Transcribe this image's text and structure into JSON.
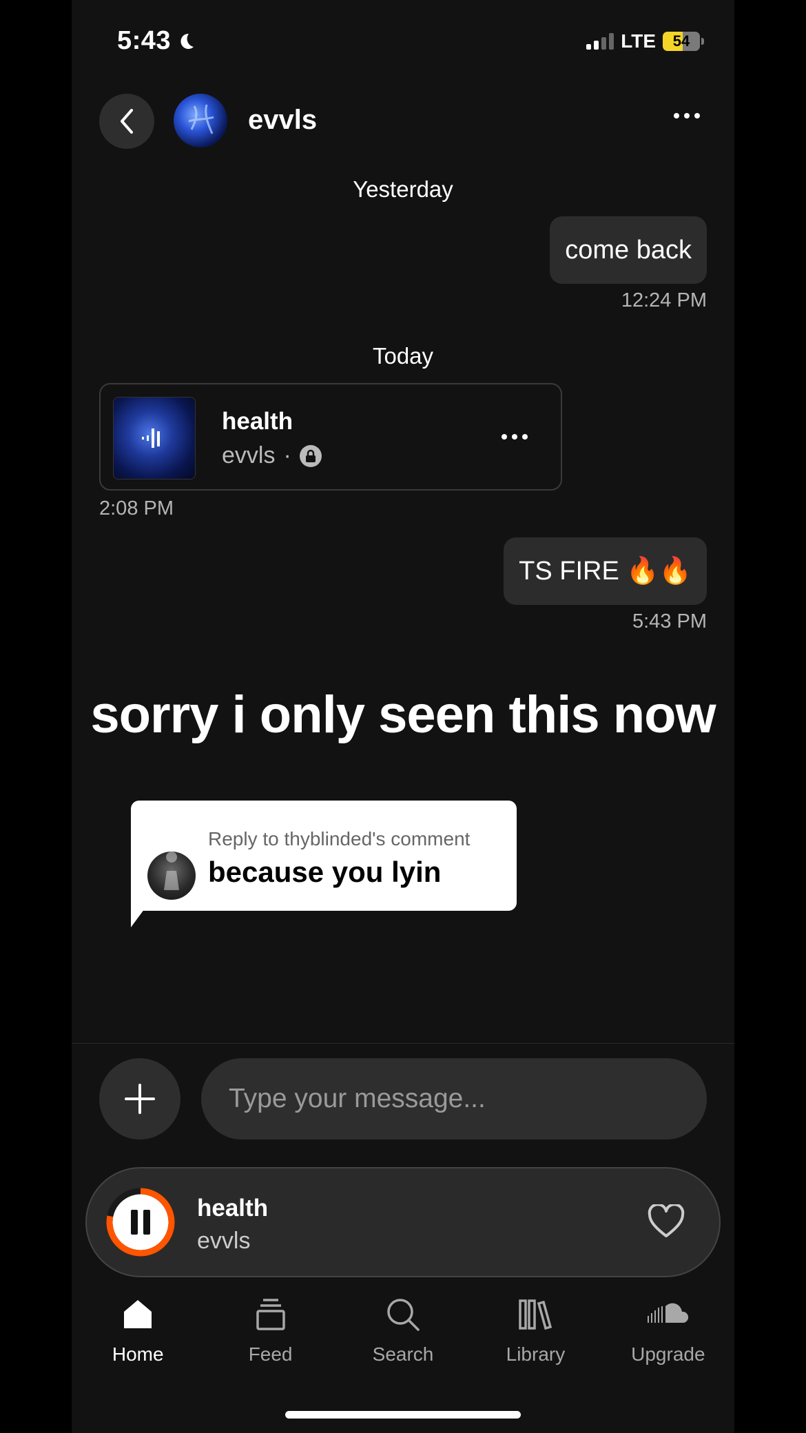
{
  "status_bar": {
    "time": "5:43",
    "network": "LTE",
    "battery": "54"
  },
  "header": {
    "contact_name": "evvls"
  },
  "messages": {
    "yesterday_label": "Yesterday",
    "msg1_text": "come back",
    "msg1_time": "12:24 PM",
    "today_label": "Today",
    "shared_track": {
      "title": "health",
      "artist": "evvls",
      "time": "2:08 PM"
    },
    "msg2_text": "TS FIRE 🔥🔥",
    "msg2_time": "5:43 PM"
  },
  "overlay": {
    "caption": "sorry i only seen this now",
    "reply_sub": "Reply to thyblinded's comment",
    "reply_text": "because you lyin"
  },
  "composer": {
    "placeholder": "Type your message..."
  },
  "player": {
    "title": "health",
    "artist": "evvls",
    "progress": 0.78,
    "accent": "#ff5500"
  },
  "nav": {
    "items": [
      {
        "label": "Home",
        "icon": "home-icon",
        "active": true
      },
      {
        "label": "Feed",
        "icon": "feed-icon"
      },
      {
        "label": "Search",
        "icon": "search-icon"
      },
      {
        "label": "Library",
        "icon": "library-icon"
      },
      {
        "label": "Upgrade",
        "icon": "soundcloud-icon"
      }
    ]
  }
}
